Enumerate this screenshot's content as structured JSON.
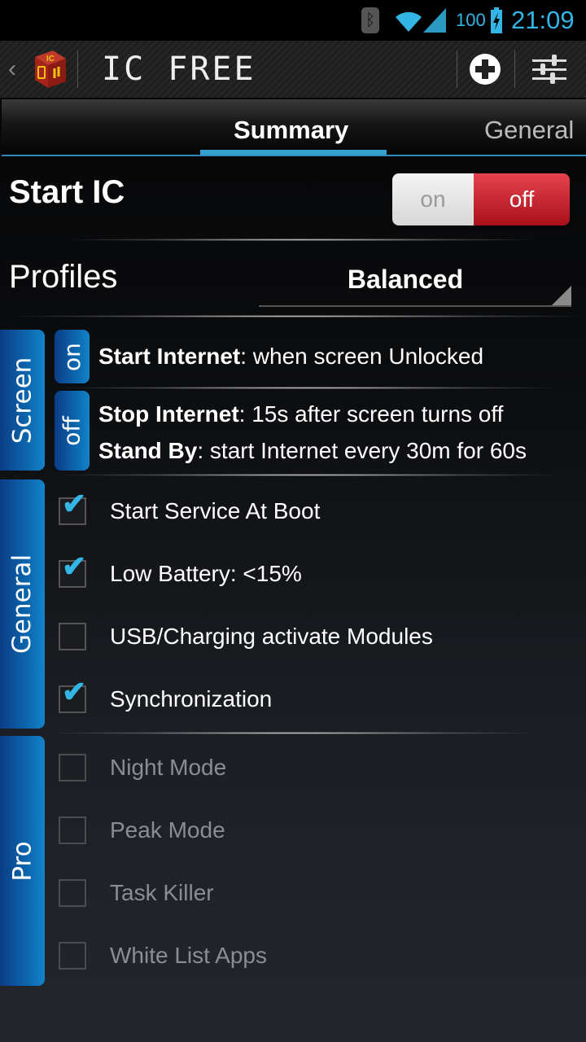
{
  "status_bar": {
    "icons": [
      "bluetooth-icon",
      "wifi-icon",
      "cell-signal-icon",
      "battery-charging-icon"
    ],
    "battery_percent": "100",
    "time": "21:09"
  },
  "action_bar": {
    "title": "IC FREE",
    "app_icon_text": "IC",
    "actions": [
      "add-icon",
      "settings-sliders-icon"
    ]
  },
  "tabs": [
    {
      "label": "Summary",
      "selected": true
    },
    {
      "label": "General",
      "selected": false
    }
  ],
  "start_ic": {
    "label": "Start IC",
    "toggle_on_label": "on",
    "toggle_off_label": "off",
    "state": "off"
  },
  "profiles": {
    "label": "Profiles",
    "selected": "Balanced"
  },
  "screen_section": {
    "label": "Screen",
    "on": {
      "tab_label": "on",
      "lines": [
        {
          "bold": "Start Internet",
          "text": ": when screen Unlocked"
        }
      ]
    },
    "off": {
      "tab_label": "off",
      "lines": [
        {
          "bold": "Stop Internet",
          "text": ": 15s after screen turns off"
        },
        {
          "bold": "Stand By",
          "text": ": start Internet every 30m for 60s"
        }
      ]
    }
  },
  "general_section": {
    "label": "General",
    "items": [
      {
        "label": "Start Service At Boot",
        "checked": true
      },
      {
        "label": "Low Battery: <15%",
        "checked": true
      },
      {
        "label": "USB/Charging activate Modules",
        "checked": false
      },
      {
        "label": "Synchronization",
        "checked": true
      }
    ]
  },
  "pro_section": {
    "label": "Pro",
    "items": [
      {
        "label": "Night Mode",
        "checked": false,
        "enabled": false
      },
      {
        "label": "Peak Mode",
        "checked": false,
        "enabled": false
      },
      {
        "label": "Task Killer",
        "checked": false,
        "enabled": false
      },
      {
        "label": "White List Apps",
        "checked": false,
        "enabled": false
      }
    ]
  },
  "colors": {
    "accent": "#33b5e5",
    "toggle_off": "#c81e2a",
    "section_tab": "#0c66ad"
  }
}
